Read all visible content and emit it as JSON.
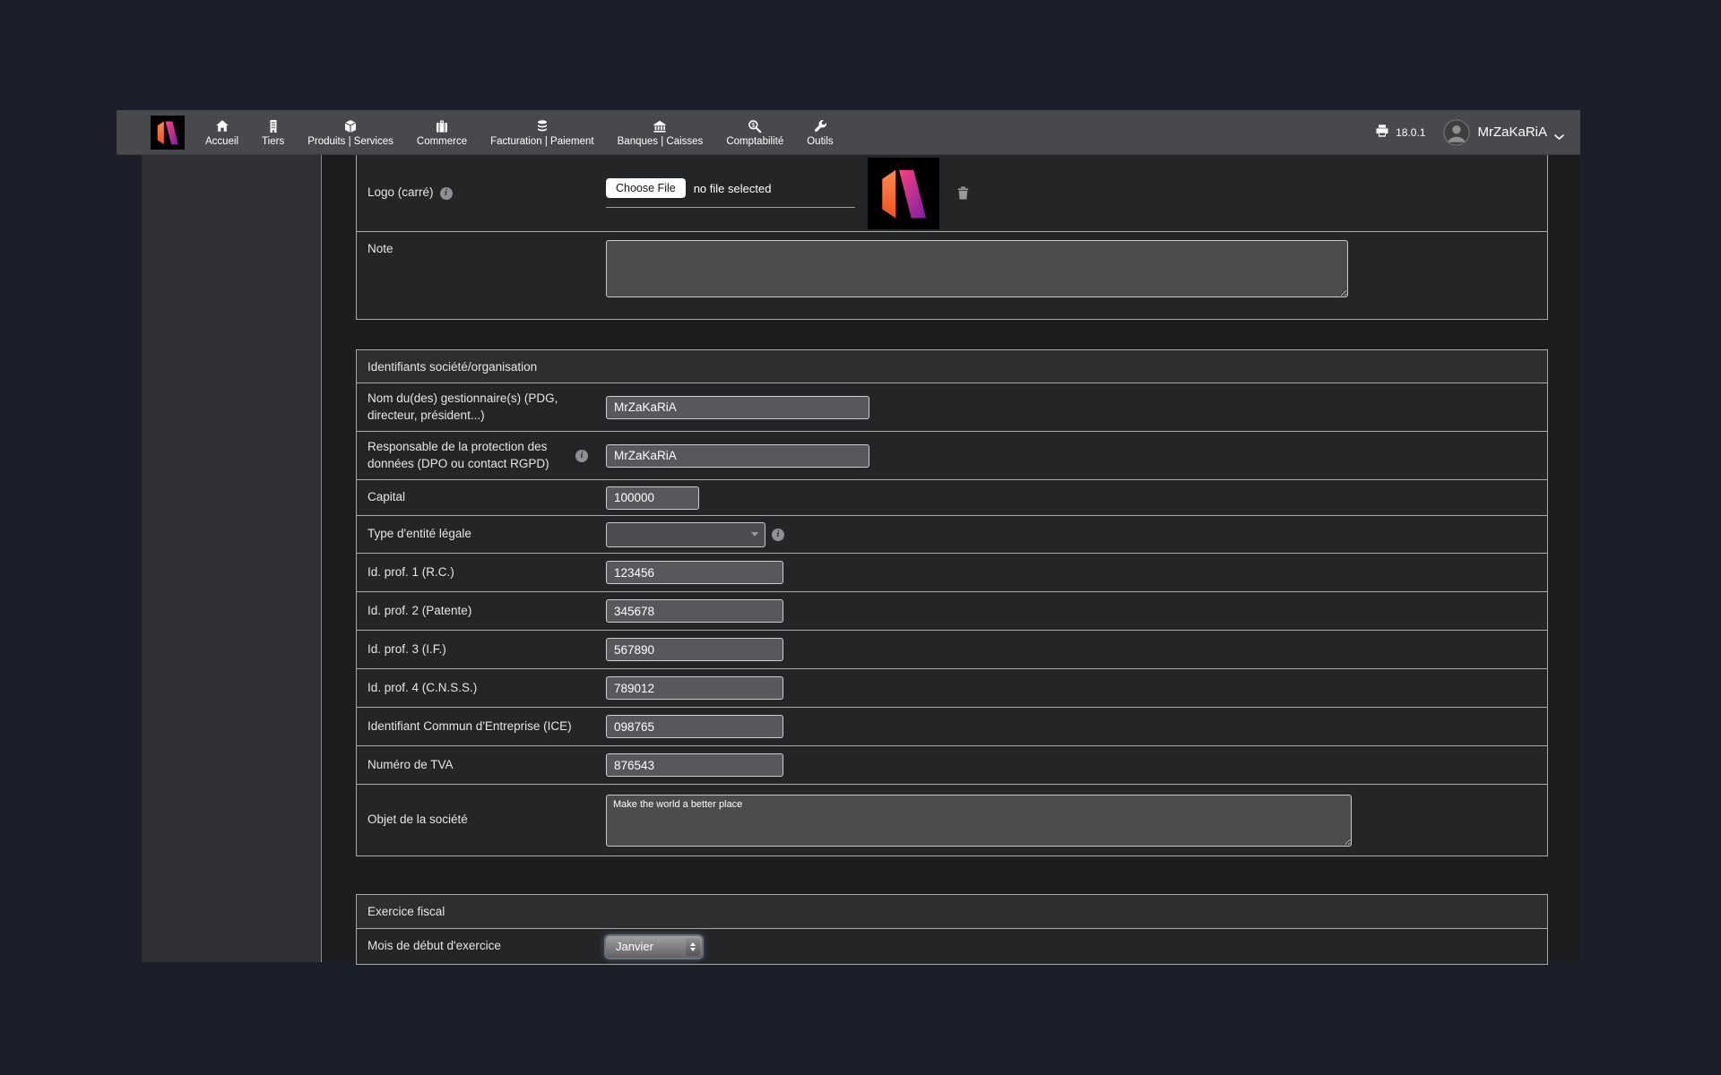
{
  "navbar": {
    "items": [
      {
        "label": "Accueil",
        "icon": "home-icon"
      },
      {
        "label": "Tiers",
        "icon": "building-icon"
      },
      {
        "label": "Produits | Services",
        "icon": "cube-icon"
      },
      {
        "label": "Commerce",
        "icon": "suitcase-icon"
      },
      {
        "label": "Facturation | Paiement",
        "icon": "coins-icon"
      },
      {
        "label": "Banques | Caisses",
        "icon": "bank-icon"
      },
      {
        "label": "Comptabilité",
        "icon": "search-dollar-icon"
      },
      {
        "label": "Outils",
        "icon": "wrench-icon"
      }
    ],
    "active_item": "Accueil",
    "version": "18.0.1",
    "user": "MrZaKaRiA"
  },
  "form": {
    "logo_row": {
      "label": "Logo (carré)",
      "button": "Choose File",
      "status": "no file selected"
    },
    "note_row": {
      "label": "Note",
      "value": ""
    },
    "identifiers": {
      "title": "Identifiants société/organisation",
      "rows": [
        {
          "label": "Nom du(des) gestionnaire(s) (PDG, directeur, président...)",
          "value": "MrZaKaRiA"
        },
        {
          "label": "Responsable de la protection des données (DPO ou contact RGPD)",
          "value": "MrZaKaRiA"
        },
        {
          "label": "Capital",
          "value": "100000"
        },
        {
          "label": "Type d'entité légale",
          "value": ""
        },
        {
          "label": "Id. prof. 1 (R.C.)",
          "value": "123456"
        },
        {
          "label": "Id. prof. 2 (Patente)",
          "value": "345678"
        },
        {
          "label": "Id. prof. 3 (I.F.)",
          "value": "567890"
        },
        {
          "label": "Id. prof. 4 (C.N.S.S.)",
          "value": "789012"
        },
        {
          "label": "Identifiant Commun d'Entreprise (ICE)",
          "value": "098765"
        },
        {
          "label": "Numéro de TVA",
          "value": "876543"
        },
        {
          "label": "Objet de la société",
          "value": "Make the world a better place"
        }
      ]
    },
    "fiscal": {
      "title": "Exercice fiscal",
      "rows": [
        {
          "label": "Mois de début d'exercice",
          "value": "Janvier"
        }
      ]
    },
    "accent_colors": {
      "logo_orange": "#f4511e",
      "logo_magenta": "#d81b60",
      "logo_purple": "#7b1fa2"
    }
  }
}
